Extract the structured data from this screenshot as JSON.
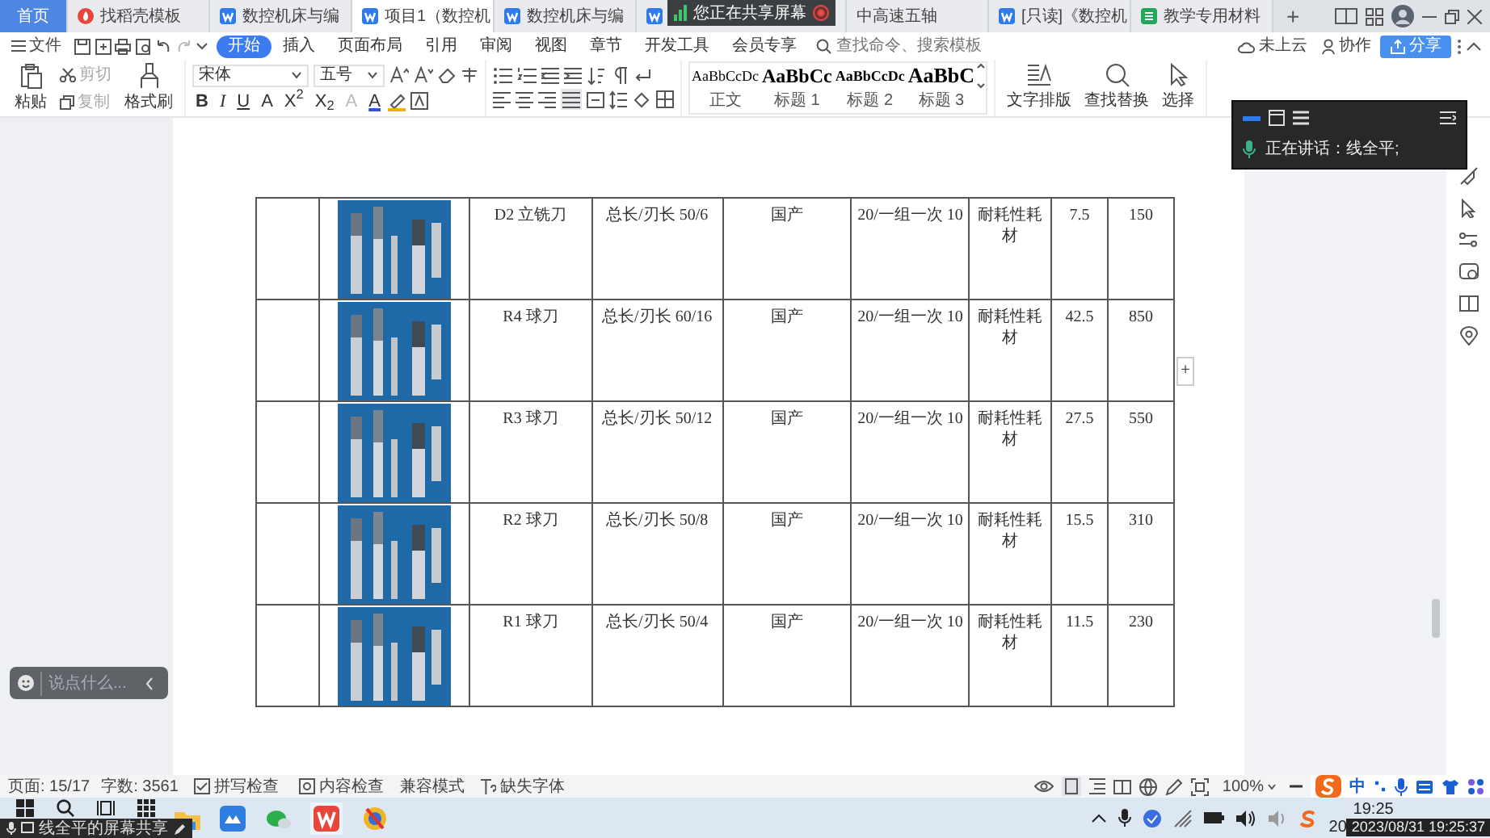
{
  "tabs": [
    {
      "label": "首页",
      "kind": "home",
      "selected": false
    },
    {
      "label": "找稻壳模板",
      "kind": "docer",
      "selected": false
    },
    {
      "label": "数控机床与编",
      "kind": "writer",
      "selected": false
    },
    {
      "label": "项目1（数控机",
      "kind": "writer",
      "selected": true
    },
    {
      "label": "数控机床与编",
      "kind": "writer",
      "selected": false
    },
    {
      "kind": "writer",
      "selected": false
    },
    {
      "label": "中高速五轴",
      "kind": "covered",
      "selected": false
    },
    {
      "label": "[只读]《数控机",
      "kind": "writer",
      "selected": false
    },
    {
      "label": "教学专用材料",
      "kind": "sheet",
      "selected": false
    }
  ],
  "new_tab": "+",
  "share_banner": "您正在共享屏幕",
  "menu": {
    "file": "文件",
    "tabs": [
      {
        "label": "开始",
        "selected": true
      },
      {
        "label": "插入",
        "selected": false
      },
      {
        "label": "页面布局",
        "selected": false
      },
      {
        "label": "引用",
        "selected": false
      },
      {
        "label": "审阅",
        "selected": false
      },
      {
        "label": "视图",
        "selected": false
      },
      {
        "label": "章节",
        "selected": false
      },
      {
        "label": "开发工具",
        "selected": false
      },
      {
        "label": "会员专享",
        "selected": false
      }
    ],
    "search_placeholder": "查找命令、搜索模板",
    "cloud": "未上云",
    "collab": "协作",
    "share": "分享"
  },
  "ribbon": {
    "paste": "粘贴",
    "cut": {
      "label": "剪切",
      "disabled": true
    },
    "copy": {
      "label": "复制",
      "disabled": true
    },
    "format_painter": "格式刷",
    "font": "宋体",
    "size": "五号",
    "format_buttons": [
      "B",
      "I",
      "U",
      "A",
      "X$^{2}$",
      "X$_{2}$",
      "A",
      "A"
    ],
    "styles": [
      {
        "preview": "AaBbCcDc",
        "label": "正文",
        "kind": "body"
      },
      {
        "preview": "AaBbCc",
        "label": "标题 1",
        "kind": "h1"
      },
      {
        "preview": "AaBbCcDc",
        "label": "标题 2",
        "kind": "h2"
      },
      {
        "preview": "AaBbC",
        "label": "标题 3",
        "kind": "h3"
      }
    ],
    "text_layout": "文字排版",
    "find_replace": "查找替换",
    "select": "选择"
  },
  "table": {
    "rows": [
      {
        "name": "D2  立铣刀",
        "spec": "总长/刃长 50/6",
        "origin": "国产",
        "pack": "20/一组一次 10",
        "category": "耐耗性耗材",
        "price": "7.5",
        "total": "150"
      },
      {
        "name": "R4  球刀",
        "spec": "总长/刃长 60/16",
        "origin": "国产",
        "pack": "20/一组一次 10",
        "category": "耐耗性耗材",
        "price": "42.5",
        "total": "850"
      },
      {
        "name": "R3  球刀",
        "spec": "总长/刃长 50/12",
        "origin": "国产",
        "pack": "20/一组一次 10",
        "category": "耐耗性耗材",
        "price": "27.5",
        "total": "550"
      },
      {
        "name": "R2  球刀",
        "spec": "总长/刃长 50/8",
        "origin": "国产",
        "pack": "20/一组一次 10",
        "category": "耐耗性耗材",
        "price": "15.5",
        "total": "310"
      },
      {
        "name": "R1  球刀",
        "spec": "总长/刃长 50/4",
        "origin": "国产",
        "pack": "20/一组一次 10",
        "category": "耐耗性耗材",
        "price": "11.5",
        "total": "230"
      }
    ]
  },
  "add_button": "+",
  "chat": {
    "placeholder": "说点什么..."
  },
  "speaking_panel": {
    "text": "正在讲话：线全平;"
  },
  "status_bar": {
    "page": "页面: 15/17",
    "words": "字数: 3561",
    "spell": "拼写检查",
    "content": "内容检查",
    "compat": "兼容模式",
    "missing_font": "缺失字体",
    "zoom": "100%"
  },
  "ime": {
    "mode": "中"
  },
  "taskbar": {
    "time": "19:25",
    "date": "20"
  },
  "recording": {
    "share_label": "线全平的屏幕共享",
    "timestamp": "2023/08/31 19:25:37"
  }
}
